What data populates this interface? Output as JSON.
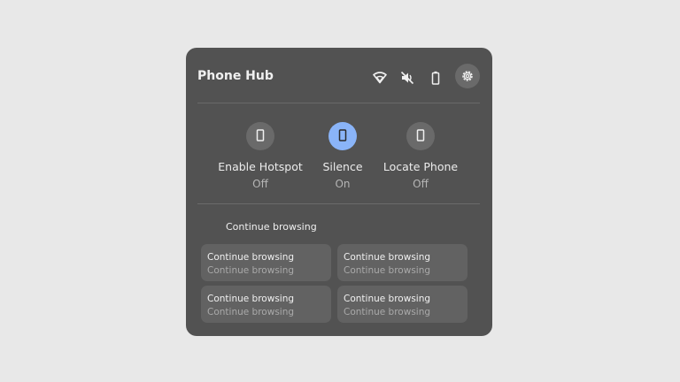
{
  "header": {
    "title": "Phone Hub",
    "icons": [
      "wifi-icon",
      "mute-icon",
      "battery-icon",
      "gear-icon"
    ]
  },
  "features": [
    {
      "label": "Enable Hotspot",
      "state": "Off",
      "icon": "phone-icon",
      "active": false
    },
    {
      "label": "Silence",
      "state": "On",
      "icon": "phone-icon",
      "active": true
    },
    {
      "label": "Locate Phone",
      "state": "Off",
      "icon": "phone-icon",
      "active": false
    }
  ],
  "browsing": {
    "section_title": "Continue browsing",
    "cards": [
      {
        "title": "Continue browsing",
        "subtitle": "Continue browsing"
      },
      {
        "title": "Continue browsing",
        "subtitle": "Continue browsing"
      },
      {
        "title": "Continue browsing",
        "subtitle": "Continue browsing"
      },
      {
        "title": "Continue browsing",
        "subtitle": "Continue browsing"
      }
    ]
  },
  "colors": {
    "panel": "#525252",
    "accent": "#8ab4f8",
    "background": "#e8e8e8"
  }
}
